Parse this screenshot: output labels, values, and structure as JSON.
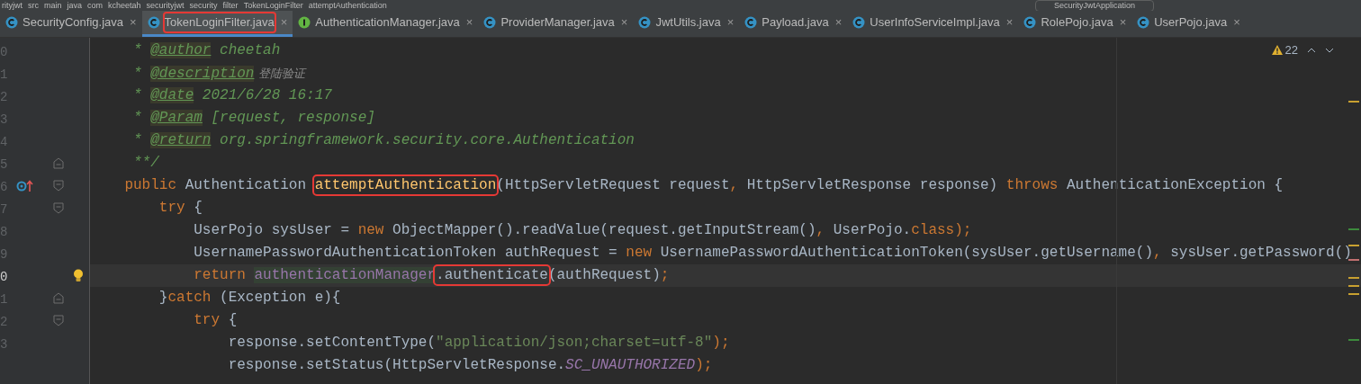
{
  "breadcrumb": [
    "rityjwt",
    "src",
    "main",
    "java",
    "com",
    "kcheetah",
    "securityjwt",
    "security",
    "filter",
    "TokenLoginFilter",
    "attemptAuthentication"
  ],
  "run_config": "SecurityJwtApplication",
  "tabs": [
    {
      "label": "SecurityConfig.java",
      "kind": "class",
      "selected": false,
      "boxed": false,
      "close": "×"
    },
    {
      "label": "TokenLoginFilter.java",
      "kind": "class",
      "selected": true,
      "boxed": true,
      "close": "×"
    },
    {
      "label": "AuthenticationManager.java",
      "kind": "interface",
      "selected": false,
      "boxed": false,
      "close": "×"
    },
    {
      "label": "ProviderManager.java",
      "kind": "class",
      "selected": false,
      "boxed": false,
      "close": "×"
    },
    {
      "label": "JwtUtils.java",
      "kind": "class",
      "selected": false,
      "boxed": false,
      "close": "×"
    },
    {
      "label": "Payload.java",
      "kind": "class",
      "selected": false,
      "boxed": false,
      "close": "×"
    },
    {
      "label": "UserInfoServiceImpl.java",
      "kind": "class",
      "selected": false,
      "boxed": false,
      "close": "×"
    },
    {
      "label": "RolePojo.java",
      "kind": "class",
      "selected": false,
      "boxed": false,
      "close": "×"
    },
    {
      "label": "UserPojo.java",
      "kind": "class",
      "selected": false,
      "boxed": false,
      "close": "×"
    }
  ],
  "warnings": "22",
  "lines": [
    {
      "number": "0",
      "current": false,
      "overridden": false,
      "fold_start": false,
      "fold_end": false,
      "bulb": false,
      "tokens": [
        {
          "text": "     * ",
          "kind": "comment"
        },
        {
          "text": "@author",
          "kind": "tag"
        },
        {
          "text": " cheetah",
          "kind": "comment"
        }
      ]
    },
    {
      "number": "1",
      "current": false,
      "overridden": false,
      "fold_start": false,
      "fold_end": false,
      "bulb": false,
      "tokens": [
        {
          "text": "     * ",
          "kind": "comment"
        },
        {
          "text": "@description",
          "kind": "tag"
        },
        {
          "text": " 登陆验证",
          "kind": "note"
        }
      ]
    },
    {
      "number": "2",
      "current": false,
      "overridden": false,
      "fold_start": false,
      "fold_end": false,
      "bulb": false,
      "tokens": [
        {
          "text": "     * ",
          "kind": "comment"
        },
        {
          "text": "@date",
          "kind": "tag"
        },
        {
          "text": " 2021/6/28 16:17",
          "kind": "comment"
        }
      ]
    },
    {
      "number": "3",
      "current": false,
      "overridden": false,
      "fold_start": false,
      "fold_end": false,
      "bulb": false,
      "tokens": [
        {
          "text": "     * ",
          "kind": "comment"
        },
        {
          "text": "@Param",
          "kind": "tag"
        },
        {
          "text": " [request, response]",
          "kind": "comment"
        }
      ]
    },
    {
      "number": "4",
      "current": false,
      "overridden": false,
      "fold_start": false,
      "fold_end": false,
      "bulb": false,
      "tokens": [
        {
          "text": "     * ",
          "kind": "comment"
        },
        {
          "text": "@return",
          "kind": "tag"
        },
        {
          "text": " org.springframework.security.core.Authentication",
          "kind": "comment"
        }
      ]
    },
    {
      "number": "5",
      "current": false,
      "overridden": false,
      "fold_start": false,
      "fold_end": true,
      "bulb": false,
      "tokens": [
        {
          "text": "     **/",
          "kind": "comment"
        }
      ]
    },
    {
      "number": "6",
      "current": false,
      "overridden": true,
      "fold_start": true,
      "fold_end": false,
      "bulb": false,
      "tokens": [
        {
          "text": "    public ",
          "kind": "keyword"
        },
        {
          "text": "Authentication ",
          "kind": "plain"
        },
        {
          "text": "attemptAuthentication",
          "kind": "method",
          "boxed": true
        },
        {
          "text": "(HttpServletRequest request",
          "kind": "plain"
        },
        {
          "text": ", ",
          "kind": "keyword"
        },
        {
          "text": "HttpServletResponse response) ",
          "kind": "plain"
        },
        {
          "text": "throws ",
          "kind": "keyword"
        },
        {
          "text": "AuthenticationException {",
          "kind": "plain"
        }
      ]
    },
    {
      "number": "7",
      "current": false,
      "overridden": false,
      "fold_start": true,
      "fold_end": false,
      "bulb": false,
      "tokens": [
        {
          "text": "        try ",
          "kind": "keyword"
        },
        {
          "text": "{",
          "kind": "plain"
        }
      ]
    },
    {
      "number": "8",
      "current": false,
      "overridden": false,
      "fold_start": false,
      "fold_end": false,
      "bulb": false,
      "tokens": [
        {
          "text": "            UserPojo sysUser = ",
          "kind": "plain"
        },
        {
          "text": "new ",
          "kind": "keyword"
        },
        {
          "text": "ObjectMapper().readValue(request.getInputStream()",
          "kind": "plain"
        },
        {
          "text": ", ",
          "kind": "keyword"
        },
        {
          "text": "UserPojo.",
          "kind": "plain"
        },
        {
          "text": "class",
          "kind": "keyword"
        },
        {
          "text": ");",
          "kind": "keyword"
        }
      ]
    },
    {
      "number": "9",
      "current": false,
      "overridden": false,
      "fold_start": false,
      "fold_end": false,
      "bulb": false,
      "tokens": [
        {
          "text": "            UsernamePasswordAuthenticationToken authRequest = ",
          "kind": "plain"
        },
        {
          "text": "new ",
          "kind": "keyword"
        },
        {
          "text": "UsernamePasswordAuthenticationToken(sysUser.getUsername()",
          "kind": "plain"
        },
        {
          "text": ", ",
          "kind": "keyword"
        },
        {
          "text": "sysUser.getPassword()",
          "kind": "plain"
        }
      ]
    },
    {
      "number": "0",
      "current": true,
      "overridden": false,
      "fold_start": false,
      "fold_end": false,
      "bulb": true,
      "tokens": [
        {
          "text": "            return ",
          "kind": "keyword"
        },
        {
          "text": "authenticationManager",
          "kind": "field"
        },
        {
          "text": ".authenticate",
          "kind": "plain",
          "boxed": true
        },
        {
          "text": "(authRequest)",
          "kind": "plain"
        },
        {
          "text": ";",
          "kind": "keyword"
        }
      ]
    },
    {
      "number": "1",
      "current": false,
      "overridden": false,
      "fold_start": false,
      "fold_end": true,
      "bulb": false,
      "tokens": [
        {
          "text": "        }",
          "kind": "plain"
        },
        {
          "text": "catch ",
          "kind": "keyword"
        },
        {
          "text": "(Exception e){",
          "kind": "plain"
        }
      ]
    },
    {
      "number": "2",
      "current": false,
      "overridden": false,
      "fold_start": true,
      "fold_end": false,
      "bulb": false,
      "tokens": [
        {
          "text": "            try ",
          "kind": "keyword"
        },
        {
          "text": "{",
          "kind": "plain"
        }
      ]
    },
    {
      "number": "3",
      "current": false,
      "overridden": false,
      "fold_start": false,
      "fold_end": false,
      "bulb": false,
      "tokens": [
        {
          "text": "                response.setContentType(",
          "kind": "plain"
        },
        {
          "text": "\"application/json;charset=utf-8\"",
          "kind": "string"
        },
        {
          "text": ");",
          "kind": "keyword"
        }
      ]
    },
    {
      "tokens": [
        {
          "text": "                response.setStatus(HttpServletResponse.",
          "kind": "plain"
        },
        {
          "text": "SC_UNAUTHORIZED",
          "kind": "static"
        },
        {
          "text": ");",
          "kind": "keyword"
        }
      ]
    }
  ]
}
